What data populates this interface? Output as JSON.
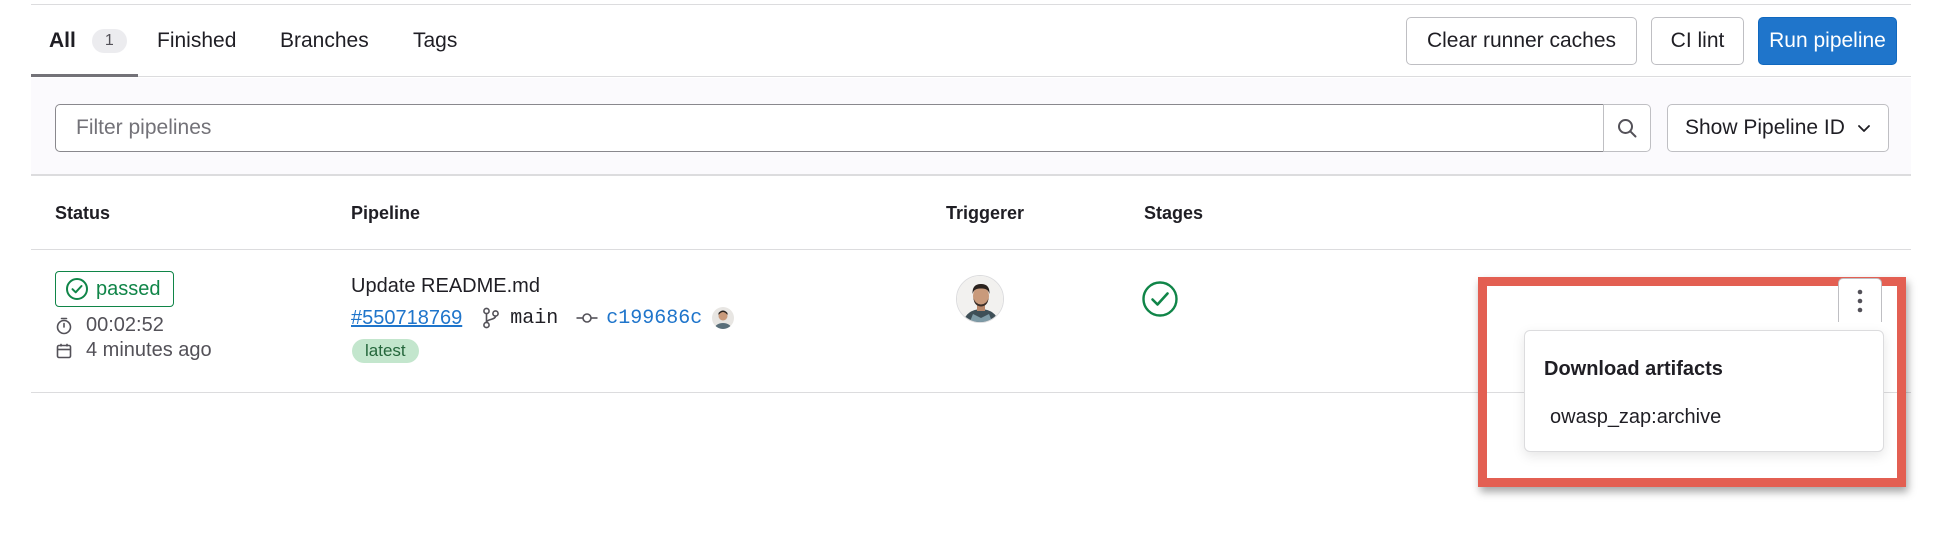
{
  "tabs": [
    {
      "label": "All",
      "count": "1"
    },
    {
      "label": "Finished"
    },
    {
      "label": "Branches"
    },
    {
      "label": "Tags"
    }
  ],
  "actions": {
    "clear_caches": "Clear runner caches",
    "ci_lint": "CI lint",
    "run_pipeline": "Run pipeline"
  },
  "filter": {
    "placeholder": "Filter pipelines",
    "show_id_label": "Show Pipeline ID"
  },
  "table": {
    "headers": [
      "Status",
      "Pipeline",
      "Triggerer",
      "Stages"
    ],
    "row": {
      "status": "passed",
      "duration": "00:02:52",
      "finished": "4 minutes ago",
      "commit_title": "Update README.md",
      "pipeline_id": "#550718769",
      "branch": "main",
      "commit_sha": "c199686c",
      "badge": "latest"
    }
  },
  "dropdown": {
    "title": "Download artifacts",
    "item": "owasp_zap:archive"
  },
  "colors": {
    "primary": "#1f75cb",
    "success": "#108548",
    "highlight": "#e35f52"
  },
  "icons": [
    "search-icon",
    "chevron-down-icon",
    "check-circle-icon",
    "clock-icon",
    "calendar-icon",
    "branch-icon",
    "commit-icon",
    "kebab-icon"
  ]
}
